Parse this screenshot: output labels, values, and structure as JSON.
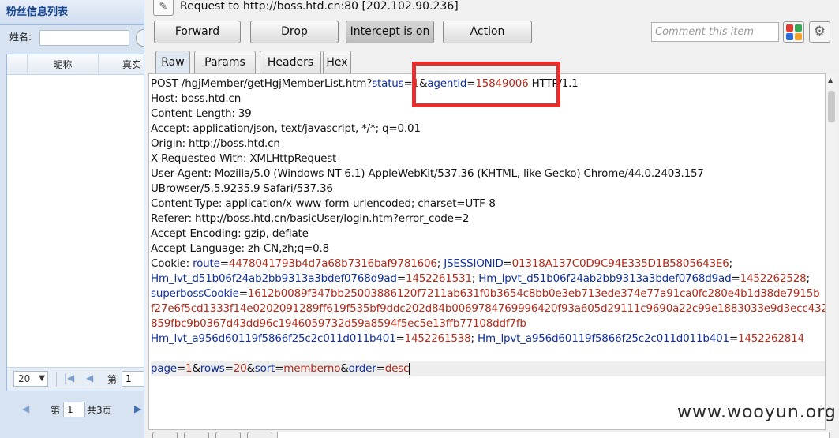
{
  "left_panel": {
    "title": "粉丝信息列表",
    "name_label": "姓名:",
    "grid_headers": [
      "昵称",
      "真实"
    ],
    "page_size": "20",
    "page_label": "第",
    "page_value": "1",
    "bottom_page_label": "第",
    "bottom_page_value": "1",
    "bottom_total": "共3页"
  },
  "burp": {
    "request_title": "Request to http://boss.htd.cn:80  [202.102.90.236]",
    "buttons": {
      "forward": "Forward",
      "drop": "Drop",
      "intercept": "Intercept is on",
      "action": "Action"
    },
    "comment_placeholder": "Comment this item",
    "tabs": [
      "Raw",
      "Params",
      "Headers",
      "Hex"
    ],
    "raw_lines": [
      "POST /hgjMember/getHgjMemberList.htm?status=1&agentid=15849006 HTTP/1.1",
      "Host: boss.htd.cn",
      "Content-Length: 39",
      "Accept: application/json, text/javascript, */*; q=0.01",
      "Origin: http://boss.htd.cn",
      "X-Requested-With: XMLHttpRequest",
      "User-Agent: Mozilla/5.0 (Windows NT 6.1) AppleWebKit/537.36 (KHTML, like Gecko) Chrome/44.0.2403.157",
      "UBrowser/5.5.9235.9 Safari/537.36",
      "Content-Type: application/x-www-form-urlencoded; charset=UTF-8",
      "Referer: http://boss.htd.cn/basicUser/login.htm?error_code=2",
      "Accept-Encoding: gzip, deflate",
      "Accept-Language: zh-CN,zh;q=0.8"
    ],
    "cookie_label": "Cookie: ",
    "cookies": [
      [
        {
          "k": "route",
          "v": "4478041793b4d7a68b7316baf9781606"
        },
        {
          "k": "JSESSIONID",
          "v": "01318A137C0D9C94E335D1B5805643E6"
        }
      ],
      [
        {
          "k": "Hm_lvt_d51b06f24ab2bb9313a3bdef0768d9ad",
          "v": "1452261531"
        },
        {
          "k": "Hm_lpvt_d51b06f24ab2bb9313a3bdef0768d9ad",
          "v": "1452262528"
        }
      ],
      [
        {
          "k": "superbossCookie",
          "v": "1612b0089f347bb25003886120f7211ab631f0b3654c8bb0e3eb713ede374e77a91ca0fc280e4b1d38de7915b"
        }
      ],
      [
        {
          "k": "",
          "v": "f27e6f5cd1333f14e0202091289ff619f535bf9ddc202d84b0069784769996420f93a605d29111c9690a22c99e1883033e9d3ecc432"
        }
      ],
      [
        {
          "k": "",
          "v": "859fbc9b0367d43dd96c1946059732d59a8594f5ec5e13ffb77108ddf7fb"
        }
      ],
      [
        {
          "k": "Hm_lvt_a956d60119f5866f25c2c011d011b401",
          "v": "1452261538"
        },
        {
          "k": "Hm_lpvt_a956d60119f5866f25c2c011d011b401",
          "v": "1452262814"
        }
      ]
    ],
    "body_params": [
      {
        "k": "page",
        "v": "1"
      },
      {
        "k": "rows",
        "v": "20"
      },
      {
        "k": "sort",
        "v": "memberno"
      },
      {
        "k": "order",
        "v": "desc"
      }
    ]
  },
  "watermark": "www.wooyun.org",
  "colors": {
    "param_key": "#0f2fa0",
    "param_value": "#b22a1a",
    "highlight": "#e42f2f"
  }
}
